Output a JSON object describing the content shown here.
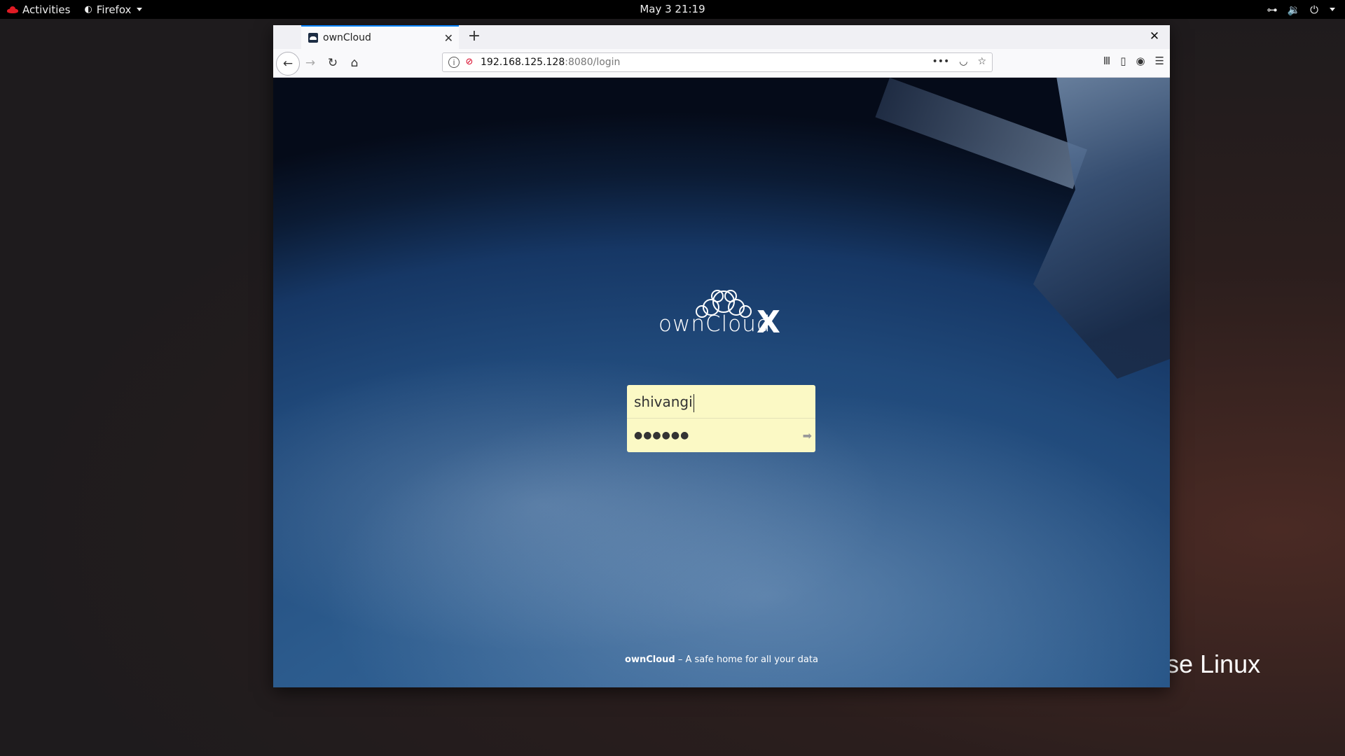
{
  "topbar": {
    "activities": "Activities",
    "app_name": "Firefox",
    "datetime": "May 3  21:19",
    "icons": [
      "network-icon",
      "volume-icon",
      "power-icon"
    ]
  },
  "desktop": {
    "brand_fragment": "se Linux"
  },
  "browser": {
    "tab_title": "ownCloud",
    "url_host": "192.168.125.128",
    "url_path": ":8080/login"
  },
  "page": {
    "logo_text": "ownCloud",
    "logo_suffix": "X",
    "username_value": "shivangi",
    "password_mask": "●●●●●●",
    "footer_brand": "ownCloud",
    "footer_tagline": " – A safe home for all your data"
  },
  "colors": {
    "login_bg": "#fbf9c5",
    "accent": "#0a84ff",
    "insecure": "#d70022"
  }
}
